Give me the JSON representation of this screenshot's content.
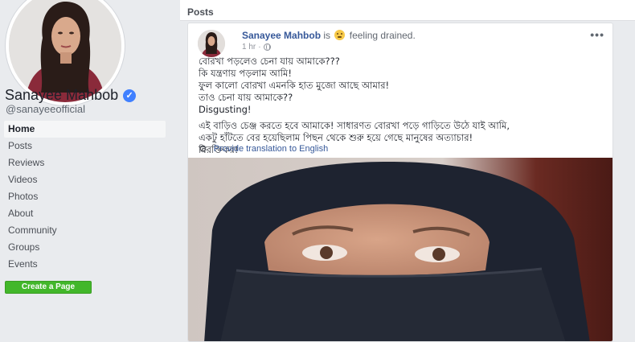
{
  "profile": {
    "name": "Sanayee Mahbob",
    "handle": "@sanayeeofficial",
    "verified_icon": "verified-badge-icon"
  },
  "nav": {
    "items": [
      {
        "label": "Home",
        "active": true
      },
      {
        "label": "Posts",
        "active": false
      },
      {
        "label": "Reviews",
        "active": false
      },
      {
        "label": "Videos",
        "active": false
      },
      {
        "label": "Photos",
        "active": false
      },
      {
        "label": "About",
        "active": false
      },
      {
        "label": "Community",
        "active": false
      },
      {
        "label": "Groups",
        "active": false
      },
      {
        "label": "Events",
        "active": false
      }
    ],
    "create_page_label": "Create a Page"
  },
  "feed": {
    "section_title": "Posts"
  },
  "post": {
    "author": "Sanayee Mahbob",
    "is_text": "is",
    "feeling_text": "feeling drained.",
    "time": "1 hr",
    "lines_block1": [
      "বোরখা পড়লেও চেনা যায় আমাকে???",
      "কি যন্ত্রণায় পড়লাম আমি!",
      "ফুল কালো বোরখা এমনকি হাত মুজো আছে আমার!",
      "তাও চেনা যায় আমাকে??",
      "Disgusting!"
    ],
    "lines_block2": [
      "এই বাড়িও চেঞ্জ করতে হবে আমাকে! সাধারণত বোরখা পড়ে গাড়িতে উঠে যাই আমি,",
      "একটু হাঁটতে বের হয়েছিলাম পিছন থেকে শুরু হয়ে গেছে মানুষের অত্যাচার!",
      "বিরক্তিকর!"
    ],
    "translate_label": "Provide translation to English"
  },
  "colors": {
    "link": "#365899",
    "create_button": "#42b72a",
    "background": "#e9ebee"
  }
}
